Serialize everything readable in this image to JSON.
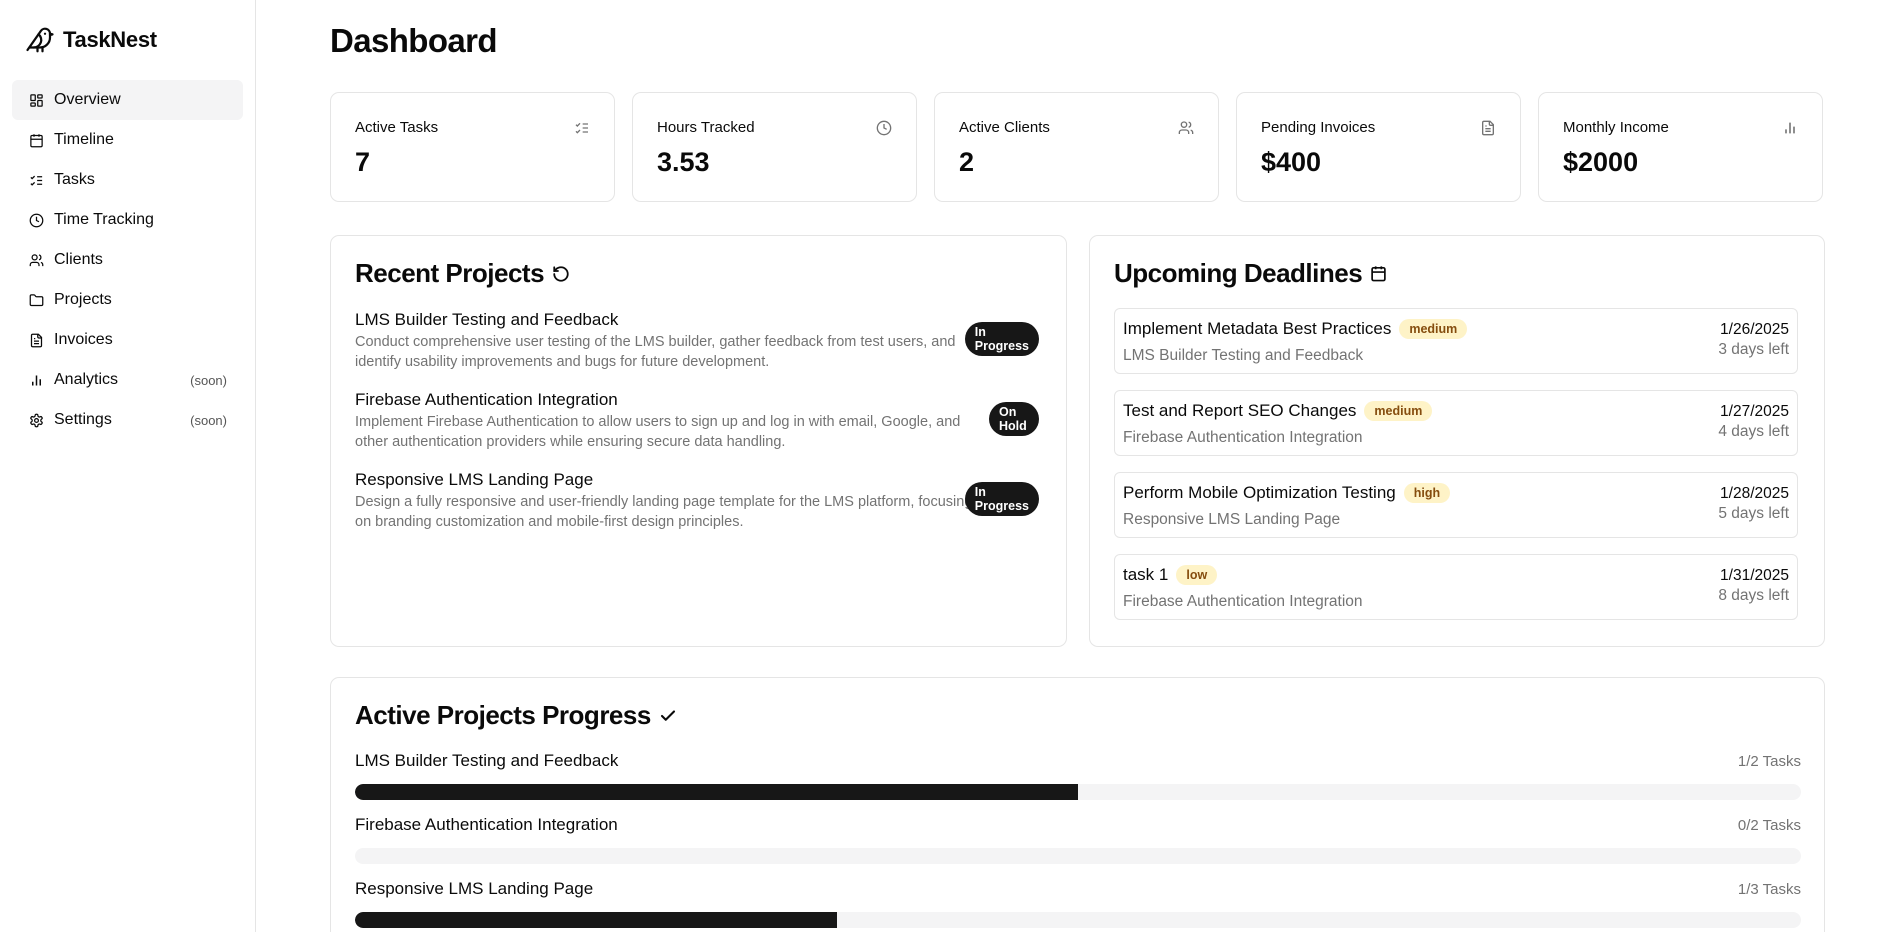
{
  "app": {
    "name": "TaskNest"
  },
  "sidebar": {
    "items": [
      {
        "label": "Overview",
        "icon": "layout-dashboard-icon",
        "active": true,
        "soon": ""
      },
      {
        "label": "Timeline",
        "icon": "calendar-icon",
        "active": false,
        "soon": ""
      },
      {
        "label": "Tasks",
        "icon": "list-checks-icon",
        "active": false,
        "soon": ""
      },
      {
        "label": "Time Tracking",
        "icon": "clock-icon",
        "active": false,
        "soon": ""
      },
      {
        "label": "Clients",
        "icon": "users-icon",
        "active": false,
        "soon": ""
      },
      {
        "label": "Projects",
        "icon": "folder-icon",
        "active": false,
        "soon": ""
      },
      {
        "label": "Invoices",
        "icon": "file-text-icon",
        "active": false,
        "soon": ""
      },
      {
        "label": "Analytics",
        "icon": "bar-chart-icon",
        "active": false,
        "soon": "(soon)"
      },
      {
        "label": "Settings",
        "icon": "gear-icon",
        "active": false,
        "soon": "(soon)"
      }
    ]
  },
  "main": {
    "title": "Dashboard",
    "stats": [
      {
        "label": "Active Tasks",
        "value": "7",
        "icon": "list-checks-icon"
      },
      {
        "label": "Hours Tracked",
        "value": "3.53",
        "icon": "clock-icon"
      },
      {
        "label": "Active Clients",
        "value": "2",
        "icon": "users-icon"
      },
      {
        "label": "Pending Invoices",
        "value": "$400",
        "icon": "file-text-icon"
      },
      {
        "label": "Monthly Income",
        "value": "$2000",
        "icon": "bar-chart-icon"
      }
    ],
    "recent_projects": {
      "title": "Recent Projects",
      "icon": "refresh-icon",
      "items": [
        {
          "name": "LMS Builder Testing and Feedback",
          "description": "Conduct comprehensive user testing of the LMS builder, gather feedback from test users, and identify usability improvements and bugs for future development.",
          "status_line1": "In",
          "status_line2": "Progress"
        },
        {
          "name": "Firebase Authentication Integration",
          "description": "Implement Firebase Authentication to allow users to sign up and log in with email, Google, and other authentication providers while ensuring secure data handling.",
          "status_line1": "On",
          "status_line2": "Hold"
        },
        {
          "name": "Responsive LMS Landing Page",
          "description": "Design a fully responsive and user-friendly landing page template for the LMS platform, focusing on branding customization and mobile-first design principles.",
          "status_line1": "In",
          "status_line2": "Progress"
        }
      ]
    },
    "deadlines": {
      "title": "Upcoming Deadlines",
      "icon": "calendar-icon",
      "items": [
        {
          "task": "Implement Metadata Best Practices",
          "priority": "medium",
          "project": "LMS Builder Testing and Feedback",
          "date": "1/26/2025",
          "left": "3 days left"
        },
        {
          "task": "Test and Report SEO Changes",
          "priority": "medium",
          "project": "Firebase Authentication Integration",
          "date": "1/27/2025",
          "left": "4 days left"
        },
        {
          "task": "Perform Mobile Optimization Testing",
          "priority": "high",
          "project": "Responsive LMS Landing Page",
          "date": "1/28/2025",
          "left": "5 days left"
        },
        {
          "task": "task 1",
          "priority": "low",
          "project": "Firebase Authentication Integration",
          "date": "1/31/2025",
          "left": "8 days left"
        }
      ]
    },
    "progress": {
      "title": "Active Projects Progress",
      "icon": "check-icon",
      "items": [
        {
          "name": "LMS Builder Testing and Feedback",
          "count": "1/2 Tasks",
          "fraction": 0.5
        },
        {
          "name": "Firebase Authentication Integration",
          "count": "0/2 Tasks",
          "fraction": 0
        },
        {
          "name": "Responsive LMS Landing Page",
          "count": "1/3 Tasks",
          "fraction": 0.3333
        }
      ]
    }
  },
  "colors": {
    "accent": "#171717",
    "muted": "#737373",
    "border": "#e5e5e5",
    "priority_bg": "#fef3c7",
    "priority_text": "#854d0e"
  }
}
